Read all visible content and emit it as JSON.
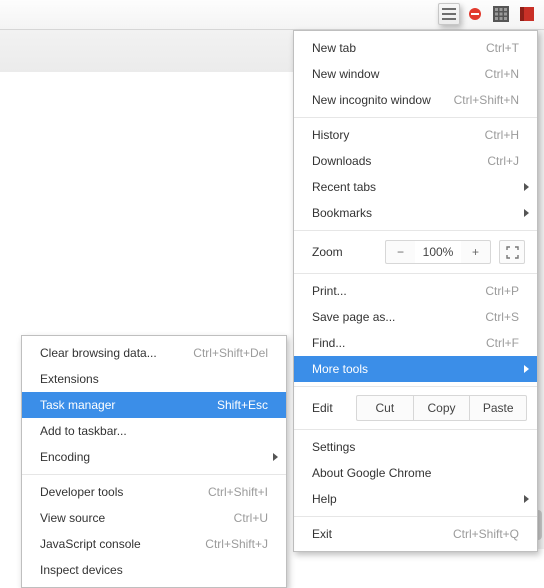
{
  "toolbar": {
    "icons": [
      "star-icon",
      "shield-red-icon",
      "grid-icon",
      "book-red-icon",
      "hamburger-menu-icon"
    ]
  },
  "main_menu": {
    "groups": [
      [
        {
          "label": "New tab",
          "shortcut": "Ctrl+T"
        },
        {
          "label": "New window",
          "shortcut": "Ctrl+N"
        },
        {
          "label": "New incognito window",
          "shortcut": "Ctrl+Shift+N"
        }
      ],
      [
        {
          "label": "History",
          "shortcut": "Ctrl+H"
        },
        {
          "label": "Downloads",
          "shortcut": "Ctrl+J"
        },
        {
          "label": "Recent tabs",
          "submenu": true
        },
        {
          "label": "Bookmarks",
          "submenu": true
        }
      ]
    ],
    "zoom": {
      "label": "Zoom",
      "minus": "−",
      "value": "100%",
      "plus": "+"
    },
    "groups2": [
      [
        {
          "label": "Print...",
          "shortcut": "Ctrl+P"
        },
        {
          "label": "Save page as...",
          "shortcut": "Ctrl+S"
        },
        {
          "label": "Find...",
          "shortcut": "Ctrl+F"
        },
        {
          "label": "More tools",
          "submenu": true,
          "selected": true
        }
      ]
    ],
    "edit": {
      "label": "Edit",
      "cut": "Cut",
      "copy": "Copy",
      "paste": "Paste"
    },
    "groups3": [
      [
        {
          "label": "Settings"
        },
        {
          "label": "About Google Chrome"
        },
        {
          "label": "Help",
          "submenu": true
        }
      ],
      [
        {
          "label": "Exit",
          "shortcut": "Ctrl+Shift+Q"
        }
      ]
    ]
  },
  "sub_menu": {
    "groups": [
      [
        {
          "label": "Clear browsing data...",
          "shortcut": "Ctrl+Shift+Del"
        },
        {
          "label": "Extensions"
        },
        {
          "label": "Task manager",
          "shortcut": "Shift+Esc",
          "selected": true
        },
        {
          "label": "Add to taskbar..."
        },
        {
          "label": "Encoding",
          "submenu": true
        }
      ],
      [
        {
          "label": "Developer tools",
          "shortcut": "Ctrl+Shift+I"
        },
        {
          "label": "View source",
          "shortcut": "Ctrl+U"
        },
        {
          "label": "JavaScript console",
          "shortcut": "Ctrl+Shift+J"
        },
        {
          "label": "Inspect devices"
        }
      ]
    ]
  }
}
